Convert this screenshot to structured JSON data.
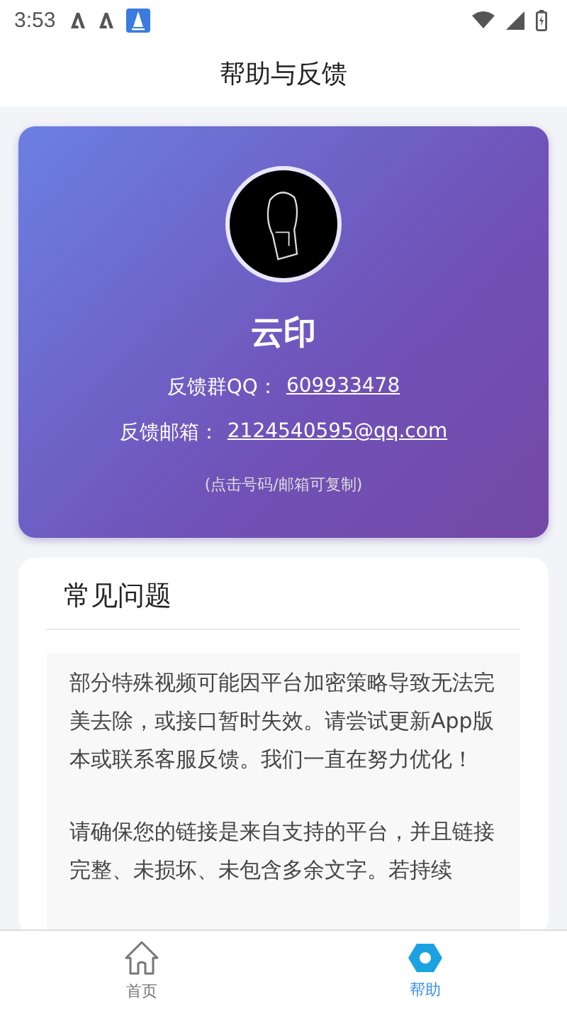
{
  "status_bar": {
    "time": "3:53"
  },
  "header": {
    "title": "帮助与反馈"
  },
  "profile": {
    "name": "云印",
    "contacts": [
      {
        "label": "反馈群QQ：",
        "value": "609933478"
      },
      {
        "label": "反馈邮箱：",
        "value": "2124540595@qq.com"
      }
    ],
    "note": "(点击号码/邮箱可复制)"
  },
  "faq": {
    "title": "常见问题",
    "paragraphs": [
      "部分特殊视频可能因平台加密策略导致无法完美去除，或接口暂时失效。请尝试更新App版本或联系客服反馈。我们一直在努力优化！",
      "请确保您的链接是来自支持的平台，并且链接完整、未损坏、未包含多余文字。若持续"
    ]
  },
  "tab_bar": [
    {
      "label": "首页",
      "kind": "home",
      "selected": false
    },
    {
      "label": "帮助",
      "kind": "help",
      "selected": true
    }
  ]
}
